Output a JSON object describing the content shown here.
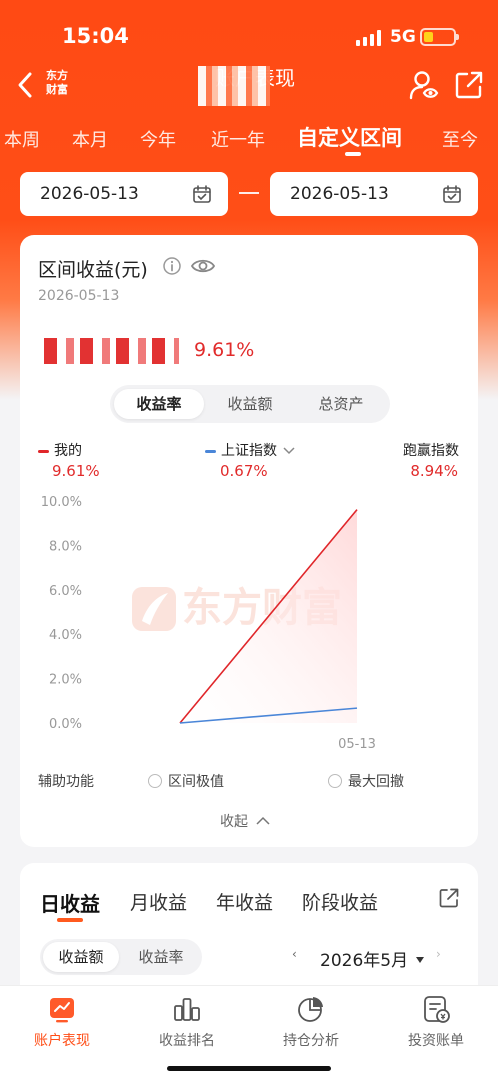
{
  "status_bar": {
    "time": "15:04",
    "network": "5G"
  },
  "header": {
    "brand_logo_line1": "东方",
    "brand_logo_line2": "财富",
    "title": "账户表现"
  },
  "period_tabs": [
    {
      "label": "本周",
      "active": false
    },
    {
      "label": "本月",
      "active": false
    },
    {
      "label": "今年",
      "active": false
    },
    {
      "label": "近一年",
      "active": false
    },
    {
      "label": "自定义区间",
      "active": true
    },
    {
      "label": "至今",
      "active": false
    }
  ],
  "date_range": {
    "start": "2026-05-13",
    "end": "2026-05-13"
  },
  "summary": {
    "title": "区间收益(元)",
    "date": "2026-05-13",
    "return_pct": "9.61%"
  },
  "metric_toggle": [
    {
      "label": "收益率",
      "active": true
    },
    {
      "label": "收益额",
      "active": false
    },
    {
      "label": "总资产",
      "active": false
    }
  ],
  "legend": {
    "mine": {
      "label": "我的",
      "value": "9.61%"
    },
    "index": {
      "label": "上证指数",
      "value": "0.67%"
    },
    "beat": {
      "label": "跑赢指数",
      "value": "8.94%"
    }
  },
  "colors": {
    "brand": "#ff4e17",
    "mine_line": "#e0262a",
    "index_line": "#4a86d8",
    "gain_text": "#e12b2b"
  },
  "chart_data": {
    "type": "line",
    "x": [
      "start",
      "05-13"
    ],
    "x_tick_labels": [
      "05-13"
    ],
    "y_tick_labels": [
      "10.0%",
      "8.0%",
      "6.0%",
      "4.0%",
      "2.0%",
      "0.0%"
    ],
    "ylim": [
      0,
      10
    ],
    "series": [
      {
        "name": "我的",
        "values": [
          0,
          9.61
        ]
      },
      {
        "name": "上证指数",
        "values": [
          0,
          0.67
        ]
      }
    ],
    "watermark": "东方财富",
    "grid": false
  },
  "aux": {
    "label": "辅助功能",
    "option1": "区间极值",
    "option2": "最大回撤",
    "collapse": "收起"
  },
  "income_tabs": [
    {
      "label": "日收益",
      "active": true
    },
    {
      "label": "月收益",
      "active": false
    },
    {
      "label": "年收益",
      "active": false
    },
    {
      "label": "阶段收益",
      "active": false
    }
  ],
  "income_sub_toggle": [
    {
      "label": "收益额",
      "active": true
    },
    {
      "label": "收益率",
      "active": false
    }
  ],
  "month_selector": {
    "label": "2026年5月"
  },
  "bottom_tabs": [
    {
      "label": "账户表现",
      "icon": "chart-icon",
      "active": true
    },
    {
      "label": "收益排名",
      "icon": "ranking-icon",
      "active": false
    },
    {
      "label": "持仓分析",
      "icon": "pie-icon",
      "active": false
    },
    {
      "label": "投资账单",
      "icon": "bill-icon",
      "active": false
    }
  ]
}
